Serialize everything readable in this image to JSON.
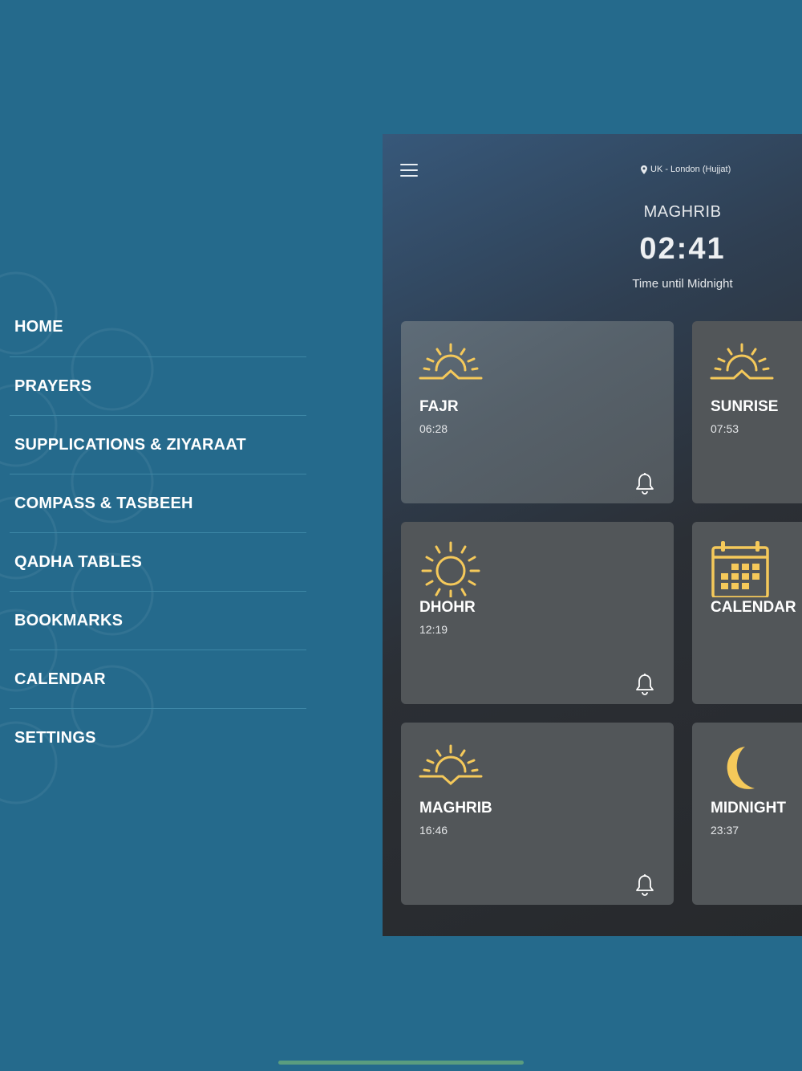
{
  "menu": {
    "items": [
      {
        "label": "HOME"
      },
      {
        "label": "PRAYERS"
      },
      {
        "label": "SUPPLICATIONS & ZIYARAAT"
      },
      {
        "label": "COMPASS & TASBEEH"
      },
      {
        "label": "QADHA TABLES"
      },
      {
        "label": "BOOKMARKS"
      },
      {
        "label": "CALENDAR"
      },
      {
        "label": "SETTINGS"
      }
    ]
  },
  "header": {
    "location": "UK - London (Hujjat)",
    "current_prayer": "MAGHRIB",
    "countdown": "02:41",
    "countdown_label": "Time until Midnight"
  },
  "cards": {
    "fajr": {
      "name": "FAJR",
      "time": "06:28",
      "icon": "sunrise-icon"
    },
    "sunrise": {
      "name": "SUNRISE",
      "time": "07:53",
      "icon": "sunrise-icon"
    },
    "dhohr": {
      "name": "DHOHR",
      "time": "12:19",
      "icon": "sun-icon"
    },
    "calendar": {
      "name": "CALENDAR",
      "icon": "calendar-icon"
    },
    "maghrib": {
      "name": "MAGHRIB",
      "time": "16:46",
      "icon": "sunset-icon"
    },
    "midnight": {
      "name": "MIDNIGHT",
      "time": "23:37",
      "icon": "moon-icon"
    }
  },
  "colors": {
    "background": "#256a8c",
    "card": "#525659",
    "accent_icon": "#f5c95a",
    "divider": "#3d87a6"
  }
}
